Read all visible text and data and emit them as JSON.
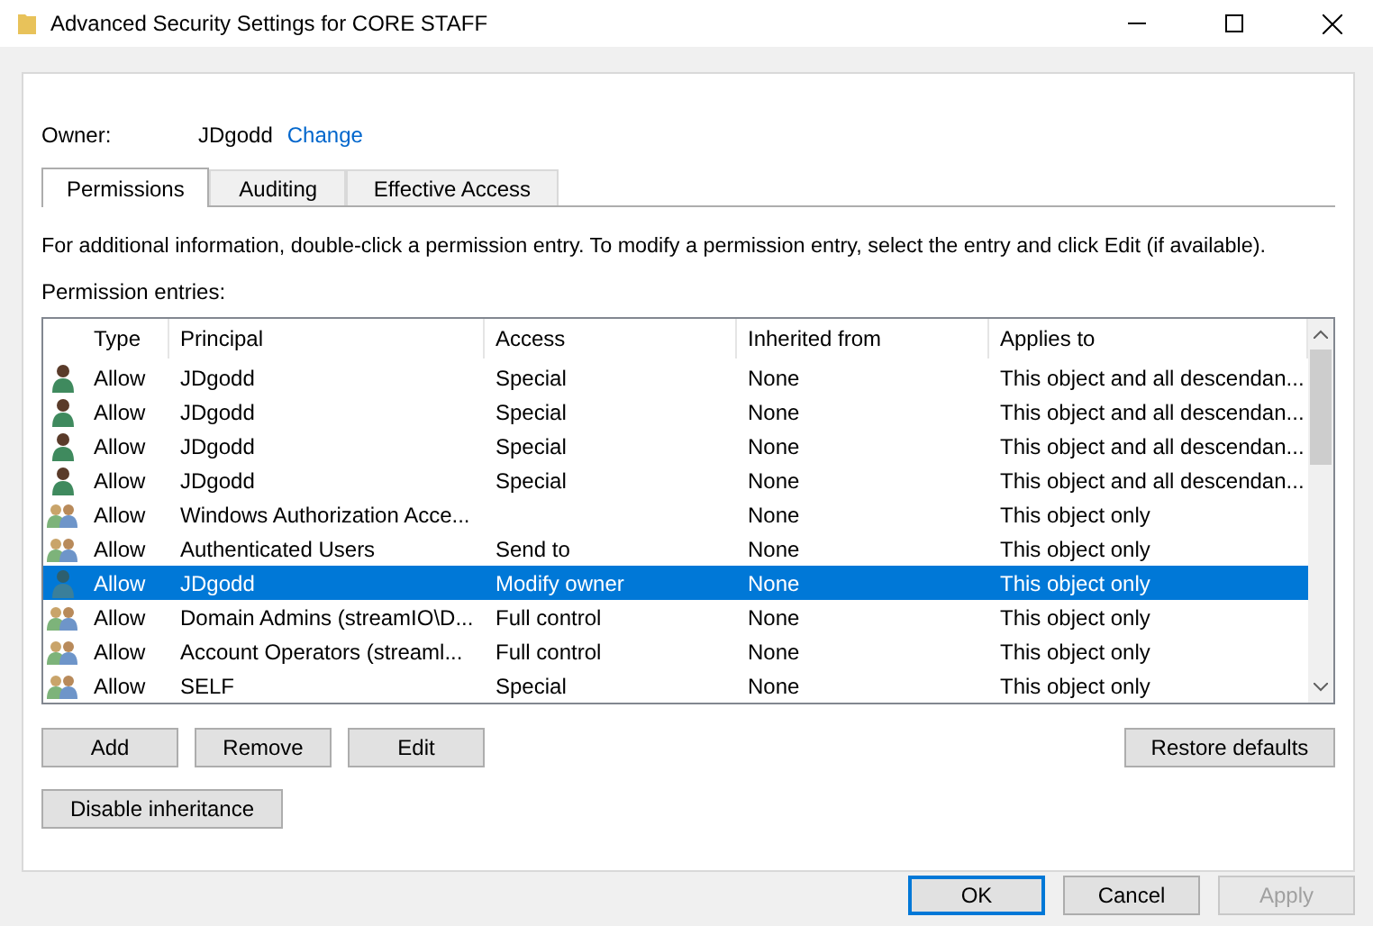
{
  "window": {
    "title": "Advanced Security Settings for CORE STAFF"
  },
  "owner": {
    "label": "Owner:",
    "value": "JDgodd",
    "link": "Change"
  },
  "tabs": [
    {
      "label": "Permissions",
      "selected": true
    },
    {
      "label": "Auditing",
      "selected": false
    },
    {
      "label": "Effective Access",
      "selected": false
    }
  ],
  "info": "For additional information, double-click a permission entry. To modify a permission entry, select the entry and click Edit (if available).",
  "entries_label": "Permission entries:",
  "table": {
    "columns": [
      "Type",
      "Principal",
      "Access",
      "Inherited from",
      "Applies to"
    ],
    "rows": [
      {
        "kind": "user",
        "selected": false,
        "cells": [
          "Allow",
          "JDgodd",
          "Special",
          "None",
          "This object and all descendan..."
        ]
      },
      {
        "kind": "user",
        "selected": false,
        "cells": [
          "Allow",
          "JDgodd",
          "Special",
          "None",
          "This object and all descendan..."
        ]
      },
      {
        "kind": "user",
        "selected": false,
        "cells": [
          "Allow",
          "JDgodd",
          "Special",
          "None",
          "This object and all descendan..."
        ]
      },
      {
        "kind": "user",
        "selected": false,
        "cells": [
          "Allow",
          "JDgodd",
          "Special",
          "None",
          "This object and all descendan..."
        ]
      },
      {
        "kind": "group",
        "selected": false,
        "cells": [
          "Allow",
          "Windows Authorization Acce...",
          "",
          "None",
          "This object only"
        ]
      },
      {
        "kind": "group",
        "selected": false,
        "cells": [
          "Allow",
          "Authenticated Users",
          "Send to",
          "None",
          "This object only"
        ]
      },
      {
        "kind": "user",
        "selected": true,
        "cells": [
          "Allow",
          "JDgodd",
          "Modify owner",
          "None",
          "This object only"
        ]
      },
      {
        "kind": "group",
        "selected": false,
        "cells": [
          "Allow",
          "Domain Admins (streamIO\\D...",
          "Full control",
          "None",
          "This object only"
        ]
      },
      {
        "kind": "group",
        "selected": false,
        "cells": [
          "Allow",
          "Account Operators (streaml...",
          "Full control",
          "None",
          "This object only"
        ]
      },
      {
        "kind": "group",
        "selected": false,
        "cells": [
          "Allow",
          "SELF",
          "Special",
          "None",
          "This object only"
        ]
      }
    ]
  },
  "entry_buttons": [
    "Add",
    "Remove",
    "Edit"
  ],
  "restore_button": "Restore defaults",
  "inheritance_button": "Disable inheritance",
  "footer_buttons": [
    {
      "label": "OK",
      "default": true,
      "disabled": false
    },
    {
      "label": "Cancel",
      "default": false,
      "disabled": false
    },
    {
      "label": "Apply",
      "default": false,
      "disabled": true
    }
  ]
}
